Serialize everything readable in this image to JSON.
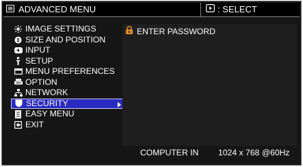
{
  "title": {
    "label": "ADVANCED MENU",
    "icon": "menu-icon"
  },
  "select_hint": {
    "label": ": SELECT",
    "icon": "select-button-icon"
  },
  "menu": {
    "items": [
      {
        "label": "IMAGE SETTINGS",
        "icon": "sun-icon"
      },
      {
        "label": "SIZE AND POSITION",
        "icon": "position-icon"
      },
      {
        "label": "INPUT",
        "icon": "input-icon"
      },
      {
        "label": "SETUP",
        "icon": "setup-icon"
      },
      {
        "label": "MENU PREFERENCES",
        "icon": "preferences-icon"
      },
      {
        "label": "OPTION",
        "icon": "option-icon"
      },
      {
        "label": "NETWORK",
        "icon": "network-icon"
      },
      {
        "label": "SECURITY",
        "icon": "shield-icon",
        "selected": true
      },
      {
        "label": "EASY MENU",
        "icon": "easy-menu-icon"
      },
      {
        "label": "EXIT",
        "icon": "exit-icon"
      }
    ]
  },
  "content": {
    "enter_password": "ENTER PASSWORD",
    "icon": "lock-icon"
  },
  "status": {
    "source": "COMPUTER IN",
    "resolution": "1024 x 768 @60Hz"
  },
  "colors": {
    "selection": "#2a2ac0",
    "background": "#161616",
    "lock": "#e08a2a"
  }
}
